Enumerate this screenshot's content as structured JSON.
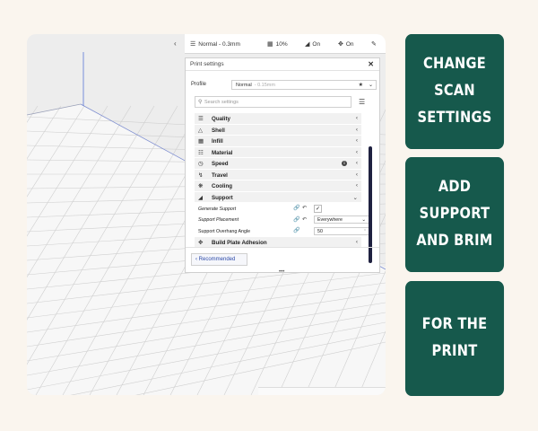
{
  "toolbar": {
    "profile_label": "Normal - 0.3mm",
    "infill_label": "10%",
    "support_label": "On",
    "adhesion_label": "On"
  },
  "panel": {
    "title": "Print settings",
    "profile_label": "Profile",
    "profile_value": "Normal",
    "profile_sub": "- 0.15mm",
    "search_placeholder": "Search settings",
    "categories": [
      {
        "label": "Quality"
      },
      {
        "label": "Shell"
      },
      {
        "label": "Infill"
      },
      {
        "label": "Material"
      },
      {
        "label": "Speed"
      },
      {
        "label": "Travel"
      },
      {
        "label": "Cooling"
      },
      {
        "label": "Support"
      }
    ],
    "support_settings": {
      "generate_support": "Generate Support",
      "support_placement": "Support Placement",
      "support_placement_value": "Everywhere",
      "overhang_angle": "Support Overhang Angle",
      "overhang_value": "50",
      "overhang_unit": "°"
    },
    "build_plate": "Build Plate Adhesion",
    "recommended_button": "Recommended"
  },
  "cards": [
    {
      "line1": "CHANGE SCAN",
      "line2": "SETTINGS"
    },
    {
      "line1": "ADD SUPPORT",
      "line2": "AND BRIM"
    },
    {
      "line1": "FOR THE PRINT",
      "line2": ""
    }
  ],
  "colors": {
    "background": "#faf5ee",
    "card_green": "#16594c",
    "scrollbar": "#1f2140",
    "accent_blue": "#2c4aa8"
  }
}
